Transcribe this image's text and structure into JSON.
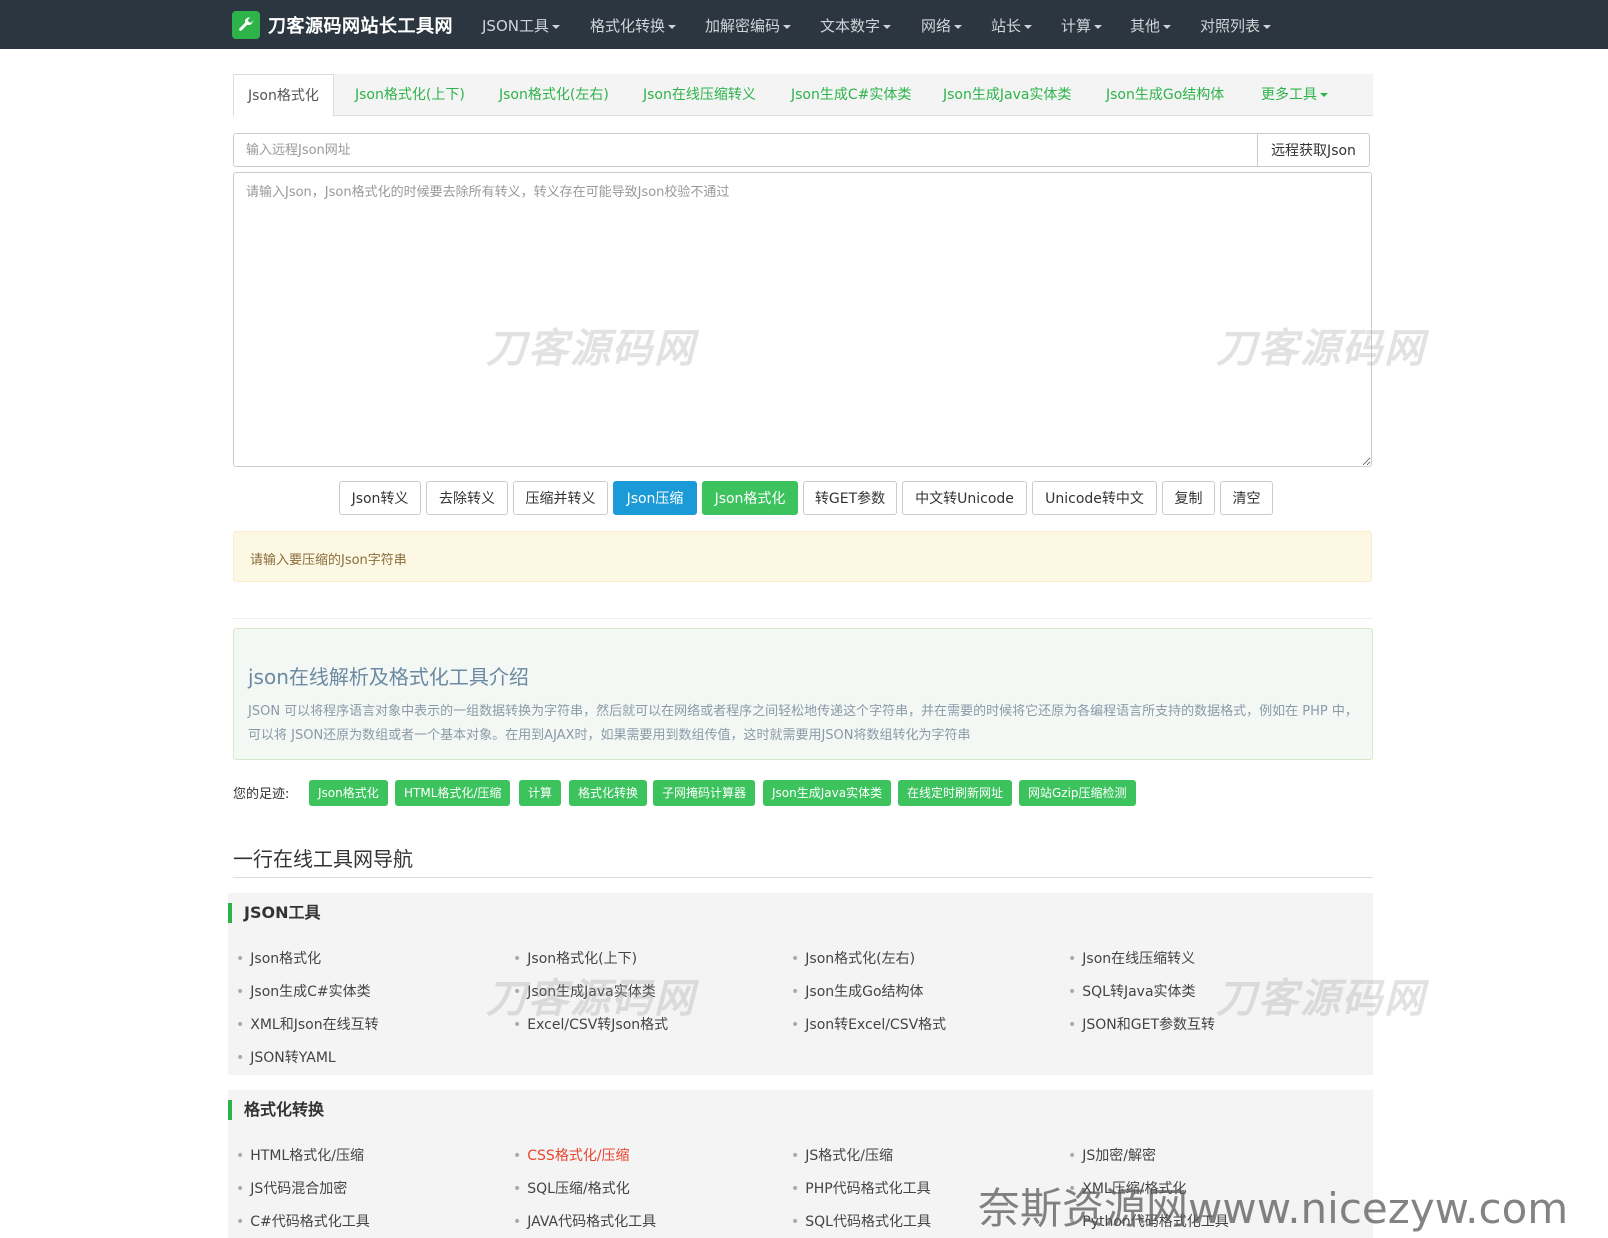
{
  "navbar": {
    "brand": "刀客源码网站长工具网",
    "items": [
      "JSON工具",
      "格式化转换",
      "加解密编码",
      "文本数字",
      "网络",
      "站长",
      "计算",
      "其他",
      "对照列表"
    ]
  },
  "tabs": [
    "Json格式化",
    "Json格式化(上下)",
    "Json格式化(左右)",
    "Json在线压缩转义",
    "Json生成C#实体类",
    "Json生成Java实体类",
    "Json生成Go结构体",
    "更多工具"
  ],
  "remote": {
    "placeholder": "输入远程Json网址",
    "button": "远程获取Json"
  },
  "editor": {
    "placeholder": "请输入Json，Json格式化的时候要去除所有转义，转义存在可能导致Json校验不通过"
  },
  "watermark_text": "刀客源码网",
  "actions": [
    "Json转义",
    "去除转义",
    "压缩并转义",
    "Json压缩",
    "Json格式化",
    "转GET参数",
    "中文转Unicode",
    "Unicode转中文",
    "复制",
    "清空"
  ],
  "alert": "请输入要压缩的Json字符串",
  "intro": {
    "title": "json在线解析及格式化工具介绍",
    "text": "JSON 可以将程序语言对象中表示的一组数据转换为字符串，然后就可以在网络或者程序之间轻松地传递这个字符串，并在需要的时候将它还原为各编程语言所支持的数据格式，例如在 PHP 中，可以将 JSON还原为数组或者一个基本对象。在用到AJAX时，如果需要用到数组传值，这时就需要用JSON将数组转化为字符串"
  },
  "footprints": {
    "label": "您的足迹:",
    "tags": [
      "Json格式化",
      "HTML格式化/压缩",
      "计算",
      "格式化转换",
      "子网掩码计算器",
      "Json生成Java实体类",
      "在线定时刷新网址",
      "网站Gzip压缩检测"
    ]
  },
  "nav_section": {
    "title": "一行在线工具网导航",
    "groups": [
      {
        "name": "JSON工具",
        "items": [
          "Json格式化",
          "Json格式化(上下)",
          "Json格式化(左右)",
          "Json在线压缩转义",
          "Json生成C#实体类",
          "Json生成Java实体类",
          "Json生成Go结构体",
          "SQL转Java实体类",
          "XML和Json在线互转",
          "Excel/CSV转Json格式",
          "Json转Excel/CSV格式",
          "JSON和GET参数互转",
          "JSON转YAML"
        ]
      },
      {
        "name": "格式化转换",
        "items": [
          "HTML格式化/压缩",
          "CSS格式化/压缩",
          "JS格式化/压缩",
          "JS加密/解密",
          "JS代码混合加密",
          "SQL压缩/格式化",
          "PHP代码格式化工具",
          "XML压缩/格式化",
          "C#代码格式化工具",
          "JAVA代码格式化工具",
          "SQL代码格式化工具",
          "Python代码格式化工具"
        ]
      }
    ]
  },
  "credit": "奈斯资源网www.nicezyw.com",
  "colors": {
    "navbar": "#2c3640",
    "accent_green": "#3cc35e",
    "accent_blue": "#1a9bd7",
    "link_green": "#2db34a",
    "alert_bg": "#fcf8e3",
    "highlight_red": "#e8452f"
  }
}
